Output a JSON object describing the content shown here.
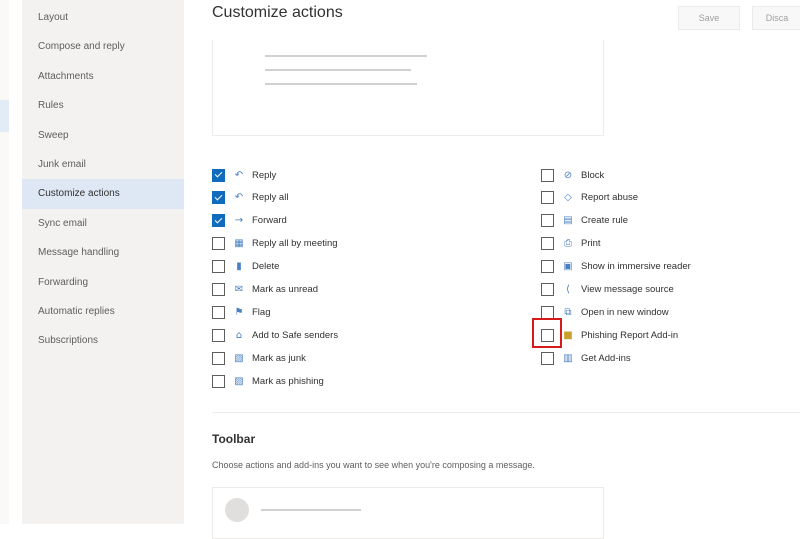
{
  "sidebar": {
    "items": [
      {
        "label": "Layout",
        "selected": false
      },
      {
        "label": "Compose and reply",
        "selected": false
      },
      {
        "label": "Attachments",
        "selected": false
      },
      {
        "label": "Rules",
        "selected": false
      },
      {
        "label": "Sweep",
        "selected": false
      },
      {
        "label": "Junk email",
        "selected": false
      },
      {
        "label": "Customize actions",
        "selected": true
      },
      {
        "label": "Sync email",
        "selected": false
      },
      {
        "label": "Message handling",
        "selected": false
      },
      {
        "label": "Forwarding",
        "selected": false
      },
      {
        "label": "Automatic replies",
        "selected": false
      },
      {
        "label": "Subscriptions",
        "selected": false
      }
    ]
  },
  "header": {
    "title": "Customize actions",
    "save_label": "Save",
    "discard_label": "Disca"
  },
  "actions": {
    "left": [
      {
        "label": "Reply",
        "checked": true,
        "icon": "reply-icon"
      },
      {
        "label": "Reply all",
        "checked": true,
        "icon": "reply-all-icon"
      },
      {
        "label": "Forward",
        "checked": true,
        "icon": "forward-icon"
      },
      {
        "label": "Reply all by meeting",
        "checked": false,
        "icon": "calendar-icon"
      },
      {
        "label": "Delete",
        "checked": false,
        "icon": "trash-icon"
      },
      {
        "label": "Mark as unread",
        "checked": false,
        "icon": "envelope-icon"
      },
      {
        "label": "Flag",
        "checked": false,
        "icon": "flag-icon"
      },
      {
        "label": "Add to Safe senders",
        "checked": false,
        "icon": "person-icon"
      },
      {
        "label": "Mark as junk",
        "checked": false,
        "icon": "junk-icon"
      },
      {
        "label": "Mark as phishing",
        "checked": false,
        "icon": "phishing-icon"
      }
    ],
    "right": [
      {
        "label": "Block",
        "checked": false,
        "icon": "block-icon"
      },
      {
        "label": "Report abuse",
        "checked": false,
        "icon": "shield-icon"
      },
      {
        "label": "Create rule",
        "checked": false,
        "icon": "rule-icon"
      },
      {
        "label": "Print",
        "checked": false,
        "icon": "printer-icon"
      },
      {
        "label": "Show in immersive reader",
        "checked": false,
        "icon": "reader-icon"
      },
      {
        "label": "View message source",
        "checked": false,
        "icon": "source-icon"
      },
      {
        "label": "Open in new window",
        "checked": false,
        "icon": "new-window-icon"
      },
      {
        "label": "Phishing Report Add-in",
        "checked": false,
        "icon": "addin-icon"
      },
      {
        "label": "Get Add-ins",
        "checked": false,
        "icon": "store-icon"
      }
    ]
  },
  "toolbar": {
    "title": "Toolbar",
    "description": "Choose actions and add-ins you want to see when you're composing a message."
  },
  "colors": {
    "accent": "#0f6cbd",
    "highlight": "#d71a1a",
    "sidebar_bg": "#f3f2f1",
    "selected_bg": "#dde8f4"
  }
}
